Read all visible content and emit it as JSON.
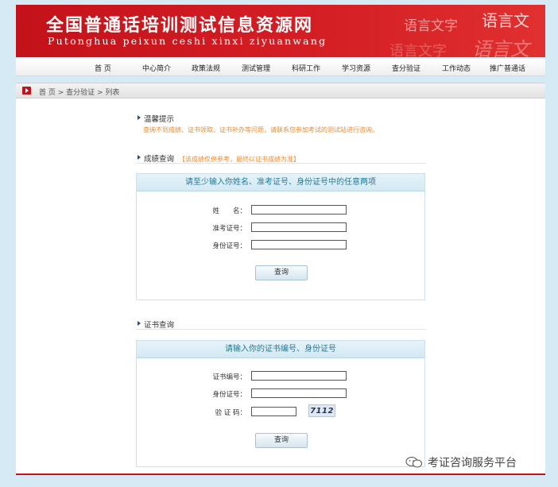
{
  "banner": {
    "title": "全国普通话培训测试信息资源网",
    "subtitle": "Putonghua peixun ceshi xinxi ziyuanwang",
    "deco": [
      "语言文字",
      "语言文",
      "语言文字",
      "语言文"
    ]
  },
  "nav": [
    "首 页",
    "中心简介",
    "政策法规",
    "测试管理",
    "科研工作",
    "学习资源",
    "查分验证",
    "工作动态",
    "推广普通话"
  ],
  "breadcrumb": [
    "首 页",
    " > ",
    "查分验证",
    " > ",
    "列表"
  ],
  "notice": {
    "heading": "温馨提示",
    "text": "查询不到成绩、证书领取、证书补办等问题，请联系您参加考试的测试站进行咨询。"
  },
  "score_query": {
    "heading": "成绩查询",
    "note": "【该成绩仅供参考，最终以证书成绩为准】",
    "panel_title": "请至少输入你姓名、准考证号、身份证号中的任意两项",
    "fields": [
      {
        "label": "姓　　名：",
        "value": ""
      },
      {
        "label": "准考证号：",
        "value": ""
      },
      {
        "label": "身份证号：",
        "value": ""
      }
    ],
    "button": "查询"
  },
  "cert_query": {
    "heading": "证书查询",
    "panel_title": "请输入你的证书编号、身份证号",
    "fields": [
      {
        "label": "证书编号：",
        "value": ""
      },
      {
        "label": "身份证号：",
        "value": ""
      },
      {
        "label": "验 证 码：",
        "value": ""
      }
    ],
    "captcha": "7112",
    "button": "查询"
  },
  "watermark": "考证咨询服务平台",
  "colors": {
    "brand_red": "#c4121a",
    "accent_orange": "#f08a2b",
    "panel_title_teal": "#1f7a9a",
    "background": "#d6eaf6"
  }
}
